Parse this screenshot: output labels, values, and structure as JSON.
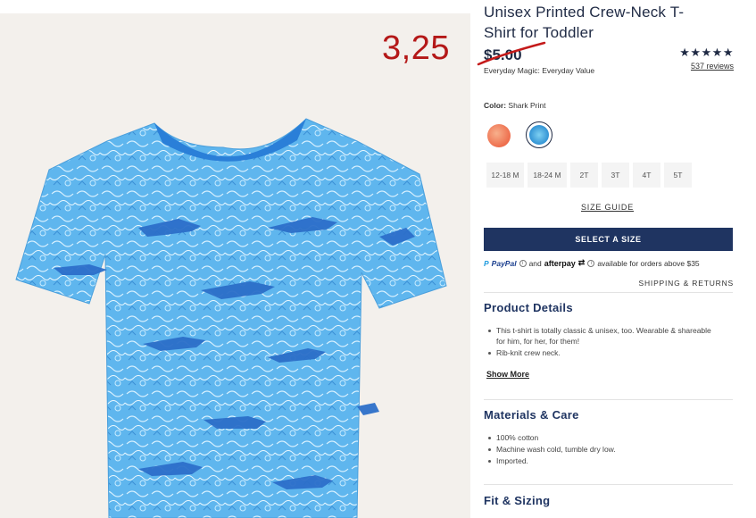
{
  "product": {
    "title": "Unisex Printed Crew-Neck T-Shirt for Toddler",
    "price": "$5.00",
    "price_tagline": "Everyday Magic: Everyday Value",
    "annotation_price": "3,25",
    "rating_stars": "★★★★★",
    "reviews": "537 reviews"
  },
  "color": {
    "label": "Color:",
    "value": "Shark Print"
  },
  "sizes": [
    "12-18 M",
    "18-24 M",
    "2T",
    "3T",
    "4T",
    "5T"
  ],
  "links": {
    "size_guide": "SIZE GUIDE",
    "shipping": "SHIPPING & RETURNS",
    "show_more": "Show More"
  },
  "buttons": {
    "select_size": "SELECT A SIZE"
  },
  "payment": {
    "paypal": "PayPal",
    "and": "and",
    "afterpay": "afterpay",
    "availability": "available for orders above $35"
  },
  "sections": {
    "details_title": "Product Details",
    "details": [
      "This t-shirt is totally classic & unisex, too. Wearable & shareable for him, for her, for them!",
      "Rib-knit crew neck."
    ],
    "materials_title": "Materials & Care",
    "materials": [
      "100% cotton",
      "Machine wash cold, tumble dry low.",
      "Imported."
    ],
    "fit_title": "Fit & Sizing"
  },
  "colors": {
    "navy": "#1f3461",
    "annotation_red": "#b41818",
    "shirt_blue": "#3a9ee0",
    "collar_blue": "#2a7fd8"
  }
}
